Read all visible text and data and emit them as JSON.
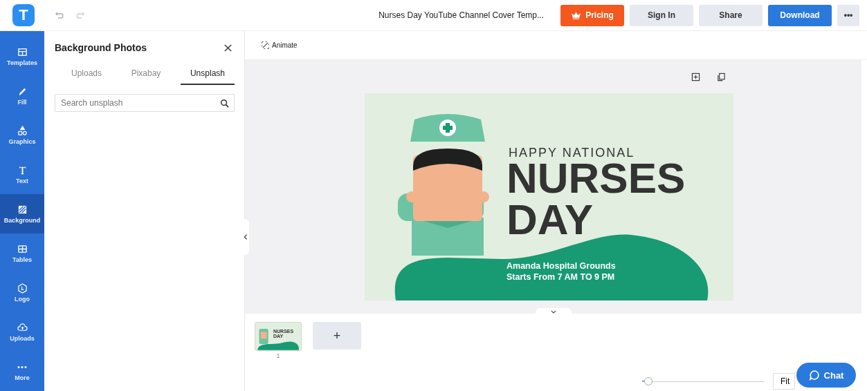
{
  "header": {
    "logo": "T",
    "title": "Nurses Day YouTube Channel Cover Temp...",
    "buttons": [
      {
        "label": "Pricing",
        "kind": "pricing"
      },
      {
        "label": "Sign In",
        "kind": "plain"
      },
      {
        "label": "Share",
        "kind": "plain"
      },
      {
        "label": "Download",
        "kind": "primary"
      },
      {
        "label": "•••",
        "kind": "plain"
      }
    ]
  },
  "sidebar": {
    "items": [
      {
        "label": "Templates",
        "kind": "templates",
        "selected": false
      },
      {
        "label": "Fill",
        "kind": "fill",
        "selected": false
      },
      {
        "label": "Graphics",
        "kind": "graphics",
        "selected": false
      },
      {
        "label": "Text",
        "kind": "text",
        "selected": false
      },
      {
        "label": "Background",
        "kind": "background",
        "selected": true
      },
      {
        "label": "Tables",
        "kind": "tables",
        "selected": false
      },
      {
        "label": "Logo",
        "kind": "logo",
        "selected": false
      },
      {
        "label": "Uploads",
        "kind": "uploads",
        "selected": false
      },
      {
        "label": "More",
        "kind": "more",
        "selected": false
      }
    ]
  },
  "panel": {
    "title": "Background Photos",
    "tabs": [
      {
        "label": "Uploads",
        "selected": false
      },
      {
        "label": "Pixabay",
        "selected": false
      },
      {
        "label": "Unsplash",
        "selected": true
      }
    ],
    "search": {
      "placeholder": "Search unsplash"
    }
  },
  "toolbar": {
    "animate": "Animate"
  },
  "design": {
    "kicker": "HAPPY NATIONAL",
    "headline_1": "NURSES",
    "headline_2": "DAY",
    "line_1": "Amanda Hospital Grounds",
    "line_2": "Starts From 7 AM TO 9 PM"
  },
  "pages": {
    "thumbnail_text": "NURSES DAY",
    "page_number": "1",
    "add": "+"
  },
  "zoom": {
    "level": 0.05,
    "fit": "Fit"
  },
  "chat": {
    "label": "Chat"
  }
}
